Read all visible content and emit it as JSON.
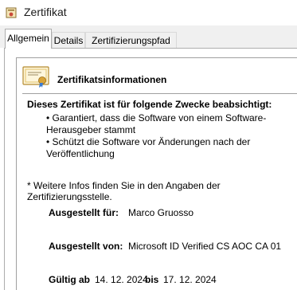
{
  "window": {
    "title": "Zertifikat"
  },
  "tabs": [
    {
      "label": "Allgemein"
    },
    {
      "label": "Details"
    },
    {
      "label": "Zertifizierungspfad"
    }
  ],
  "info": {
    "title": "Zertifikatsinformationen",
    "purpose_heading": "Dieses Zertifikat ist für folgende Zwecke beabsichtigt:",
    "purposes": [
      {
        "line1": "• Garantiert, dass die Software von einem Software-",
        "line2": "Herausgeber stammt"
      },
      {
        "line1": "• Schützt die Software vor Änderungen nach der",
        "line2": "Veröffentlichung"
      }
    ],
    "note": "* Weitere Infos finden Sie in den Angaben der Zertifizierungsstelle."
  },
  "details": {
    "issued_to_label": "Ausgestellt für:",
    "issued_to_value": "Marco Gruosso",
    "issued_by_label": "Ausgestellt von:",
    "issued_by_value": "Microsoft ID Verified CS AOC CA 01",
    "valid_from_label": "Gültig ab",
    "valid_from_value": "14. 12. 2024",
    "valid_to_label": "bis",
    "valid_to_value": "17. 12. 2024"
  },
  "colors": {
    "window_bg": "#ffffff",
    "tab_bg": "#f0f0f0",
    "border": "#adadad",
    "cert_gold": "#d9a43a"
  }
}
